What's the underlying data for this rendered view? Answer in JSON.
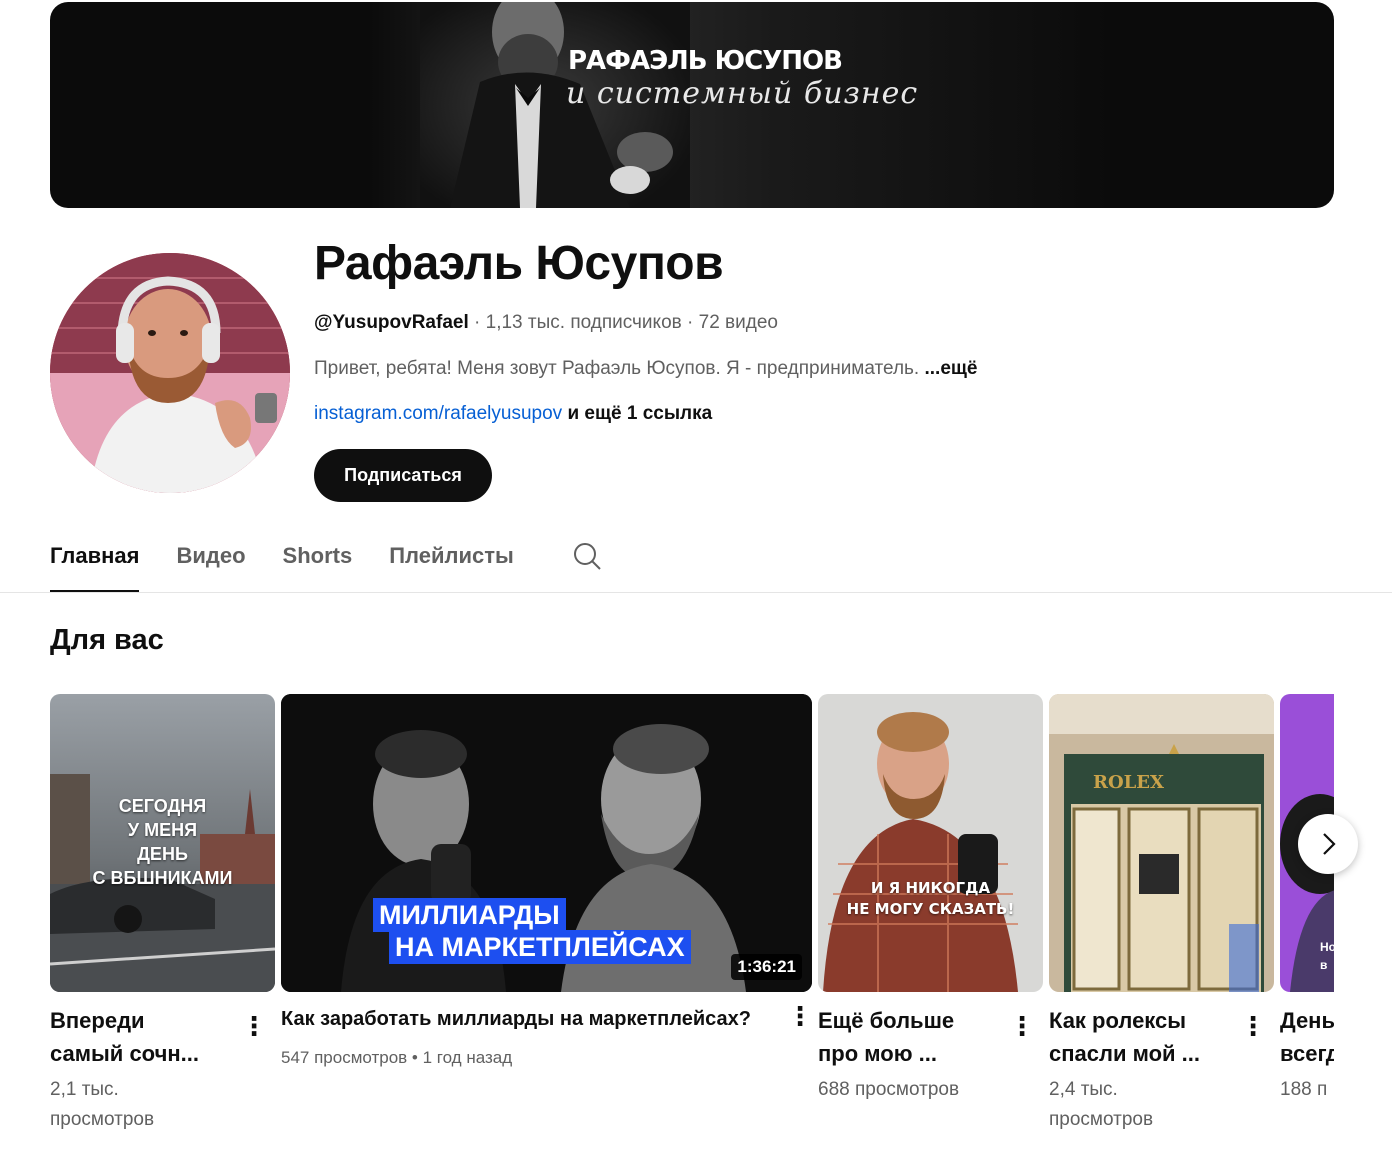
{
  "banner": {
    "title": "РАФАЭЛЬ ЮСУПОВ",
    "subtitle": "и системный бизнес"
  },
  "channel": {
    "name": "Рафаэль Юсупов",
    "handle": "@YusupovRafael",
    "subscribers": "1,13 тыс. подписчиков",
    "video_count": "72 видео",
    "separator": "·",
    "description": "Привет, ребята! Меня зовут Рафаэль Юсупов. Я - предприниматель.",
    "description_more": "...ещё",
    "link": "instagram.com/rafaelyusupov",
    "more_links": "и ещё 1 ссылка",
    "subscribe_label": "Подписаться"
  },
  "tabs": [
    {
      "label": "Главная",
      "active": true
    },
    {
      "label": "Видео",
      "active": false
    },
    {
      "label": "Shorts",
      "active": false
    },
    {
      "label": "Плейлисты",
      "active": false
    }
  ],
  "section": {
    "title": "Для вас"
  },
  "cards": [
    {
      "overlay_text": [
        "СЕГОДНЯ",
        "У МЕНЯ",
        "ДЕНЬ",
        "С ВБШНИКАМИ"
      ],
      "title_lines": [
        "Впереди",
        "самый сочн..."
      ],
      "meta_lines": [
        "2,1 тыс.",
        "просмотров"
      ]
    },
    {
      "overlay_text": [
        "МИЛЛИАРДЫ",
        "НА МАРКЕТПЛЕЙСАХ"
      ],
      "duration": "1:36:21",
      "title_lines": [
        "Как заработать миллиарды на маркетплейсах?"
      ],
      "meta_lines": [
        "547 просмотров • 1 год назад"
      ]
    },
    {
      "overlay_text": [
        "И Я НИКОГДА",
        "НЕ МОГУ СКАЗАТЬ!"
      ],
      "title_lines": [
        "Ещё больше",
        "про мою ..."
      ],
      "meta_lines": [
        "688 просмотров"
      ]
    },
    {
      "overlay_text": [
        "ROLEX"
      ],
      "title_lines": [
        "Как ролексы",
        "спасли мой ..."
      ],
      "meta_lines": [
        "2,4 тыс.",
        "просмотров"
      ]
    },
    {
      "overlay_text": [
        "Но",
        "в"
      ],
      "title_lines": [
        "День",
        "всегд"
      ],
      "meta_lines": [
        "188 п"
      ]
    }
  ],
  "colors": {
    "accent": "#065fd4",
    "primary_text": "#0f0f0f",
    "secondary_text": "#606060",
    "highlight_blue": "#1d4ff0"
  }
}
